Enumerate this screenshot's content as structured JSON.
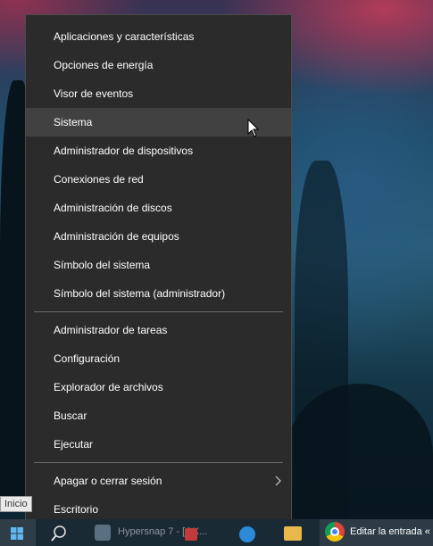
{
  "menu": {
    "items_top": [
      {
        "label": "Aplicaciones y características"
      },
      {
        "label": "Opciones de energía"
      },
      {
        "label": "Visor de eventos"
      },
      {
        "label": "Sistema"
      },
      {
        "label": "Administrador de dispositivos"
      },
      {
        "label": "Conexiones de red"
      },
      {
        "label": "Administración de discos"
      },
      {
        "label": "Administración de equipos"
      },
      {
        "label": "Símbolo del sistema"
      },
      {
        "label": "Símbolo del sistema (administrador)"
      }
    ],
    "items_middle": [
      {
        "label": "Administrador de tareas"
      },
      {
        "label": "Configuración"
      },
      {
        "label": "Explorador de archivos"
      },
      {
        "label": "Buscar"
      },
      {
        "label": "Ejecutar"
      }
    ],
    "items_bottom": [
      {
        "label": "Apagar o cerrar sesión",
        "submenu_icon": "chevron-right-icon"
      },
      {
        "label": "Escritorio"
      }
    ],
    "hovered_item": "Sistema"
  },
  "taskbar": {
    "start_tooltip": "Inicio",
    "app_label_1": "Hypersnap 7 - [QX...",
    "app_label_2": "Editar la entrada «"
  },
  "colors": {
    "menu_bg": "#2b2b2b",
    "hover_bg": "#414141",
    "text": "#ffffff",
    "separator": "#6a6a6a"
  }
}
